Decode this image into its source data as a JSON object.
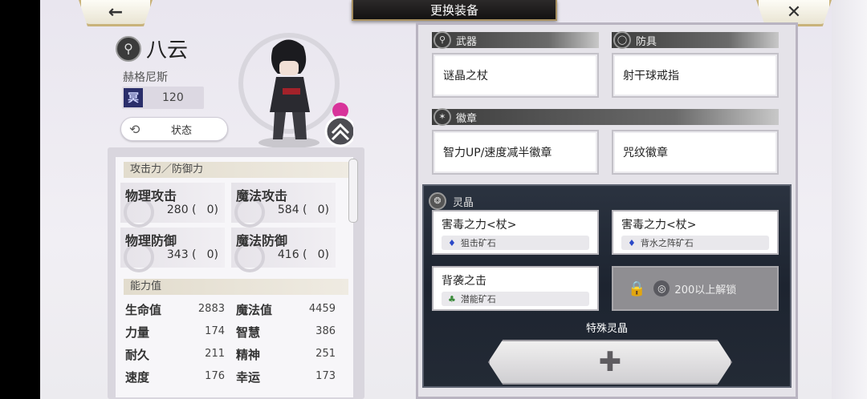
{
  "header": {
    "title": "更换装备",
    "back_icon": "←",
    "close_icon": "✕"
  },
  "character": {
    "name": "八云",
    "subname": "赫格尼斯",
    "rank_mark": "冥",
    "level": "120",
    "status_label": "状态"
  },
  "stats": {
    "section1": "攻击力／防御力",
    "attack": [
      {
        "label": "物理攻击",
        "value": "280",
        "bonus": "0"
      },
      {
        "label": "魔法攻击",
        "value": "584",
        "bonus": "0"
      },
      {
        "label": "物理防御",
        "value": "343",
        "bonus": "0"
      },
      {
        "label": "魔法防御",
        "value": "416",
        "bonus": "0"
      }
    ],
    "section2": "能力值",
    "abilities": [
      {
        "label": "生命值",
        "value": "2883"
      },
      {
        "label": "魔法值",
        "value": "4459"
      },
      {
        "label": "力量",
        "value": "174"
      },
      {
        "label": "智慧",
        "value": "386"
      },
      {
        "label": "耐久",
        "value": "211"
      },
      {
        "label": "精神",
        "value": "251"
      },
      {
        "label": "速度",
        "value": "176"
      },
      {
        "label": "幸运",
        "value": "173"
      }
    ]
  },
  "equipment": {
    "weapon_header": "武器",
    "armor_header": "防具",
    "badge_header": "徽章",
    "weapon": "谜晶之杖",
    "armor": "射干球戒指",
    "badge1": "智力UP/速度减半徽章",
    "badge2": "咒纹徽章"
  },
  "crystals": {
    "header": "灵晶",
    "slots": [
      {
        "name": "害毒之力<杖>",
        "stone": "狙击矿石"
      },
      {
        "name": "害毒之力<杖>",
        "stone": "背水之阵矿石"
      },
      {
        "name": "背袭之击",
        "stone": "潜能矿石"
      }
    ],
    "locked_label": "200以上解锁",
    "special_label": "特殊灵晶",
    "add_symbol": "✚"
  }
}
